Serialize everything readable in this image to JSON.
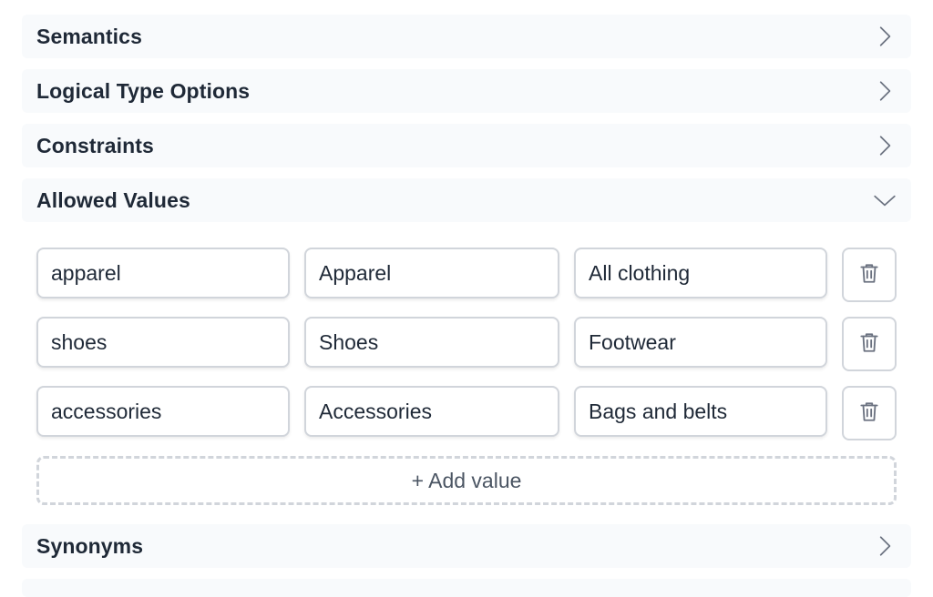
{
  "sections": {
    "semantics": {
      "title": "Semantics",
      "state": "collapsed"
    },
    "logical_type_options": {
      "title": "Logical Type Options",
      "state": "collapsed"
    },
    "constraints": {
      "title": "Constraints",
      "state": "collapsed"
    },
    "allowed_values": {
      "title": "Allowed Values",
      "state": "expanded",
      "rows": [
        {
          "value": "apparel",
          "label": "Apparel",
          "description": "All clothing"
        },
        {
          "value": "shoes",
          "label": "Shoes",
          "description": "Footwear"
        },
        {
          "value": "accessories",
          "label": "Accessories",
          "description": "Bags and belts"
        }
      ],
      "add_label": "+ Add value"
    },
    "synonyms": {
      "title": "Synonyms",
      "state": "collapsed"
    }
  },
  "icons": {
    "collapsed": "chevron-right-icon",
    "expanded": "chevron-down-icon",
    "delete": "trash-icon"
  },
  "colors": {
    "panel_bg": "#f8fafc",
    "text": "#1f2937",
    "border": "#d1d5db",
    "icon": "#6b7280"
  }
}
